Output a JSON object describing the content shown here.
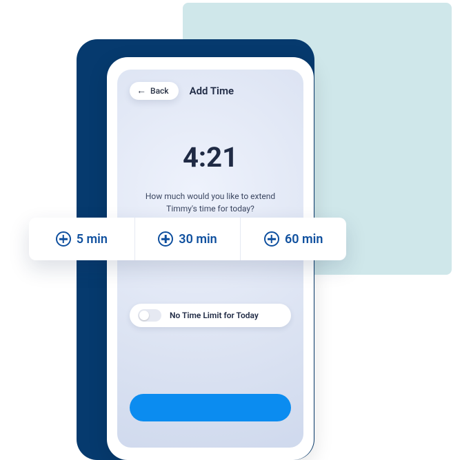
{
  "header": {
    "back_label": "Back",
    "title": "Add Time"
  },
  "main": {
    "time": "4:21",
    "prompt": "How much would you like to extend Timmy's time for today?"
  },
  "options": [
    {
      "label": "5 min"
    },
    {
      "label": "30 min"
    },
    {
      "label": "60 min"
    }
  ],
  "toggle": {
    "label": "No Time Limit for Today"
  }
}
